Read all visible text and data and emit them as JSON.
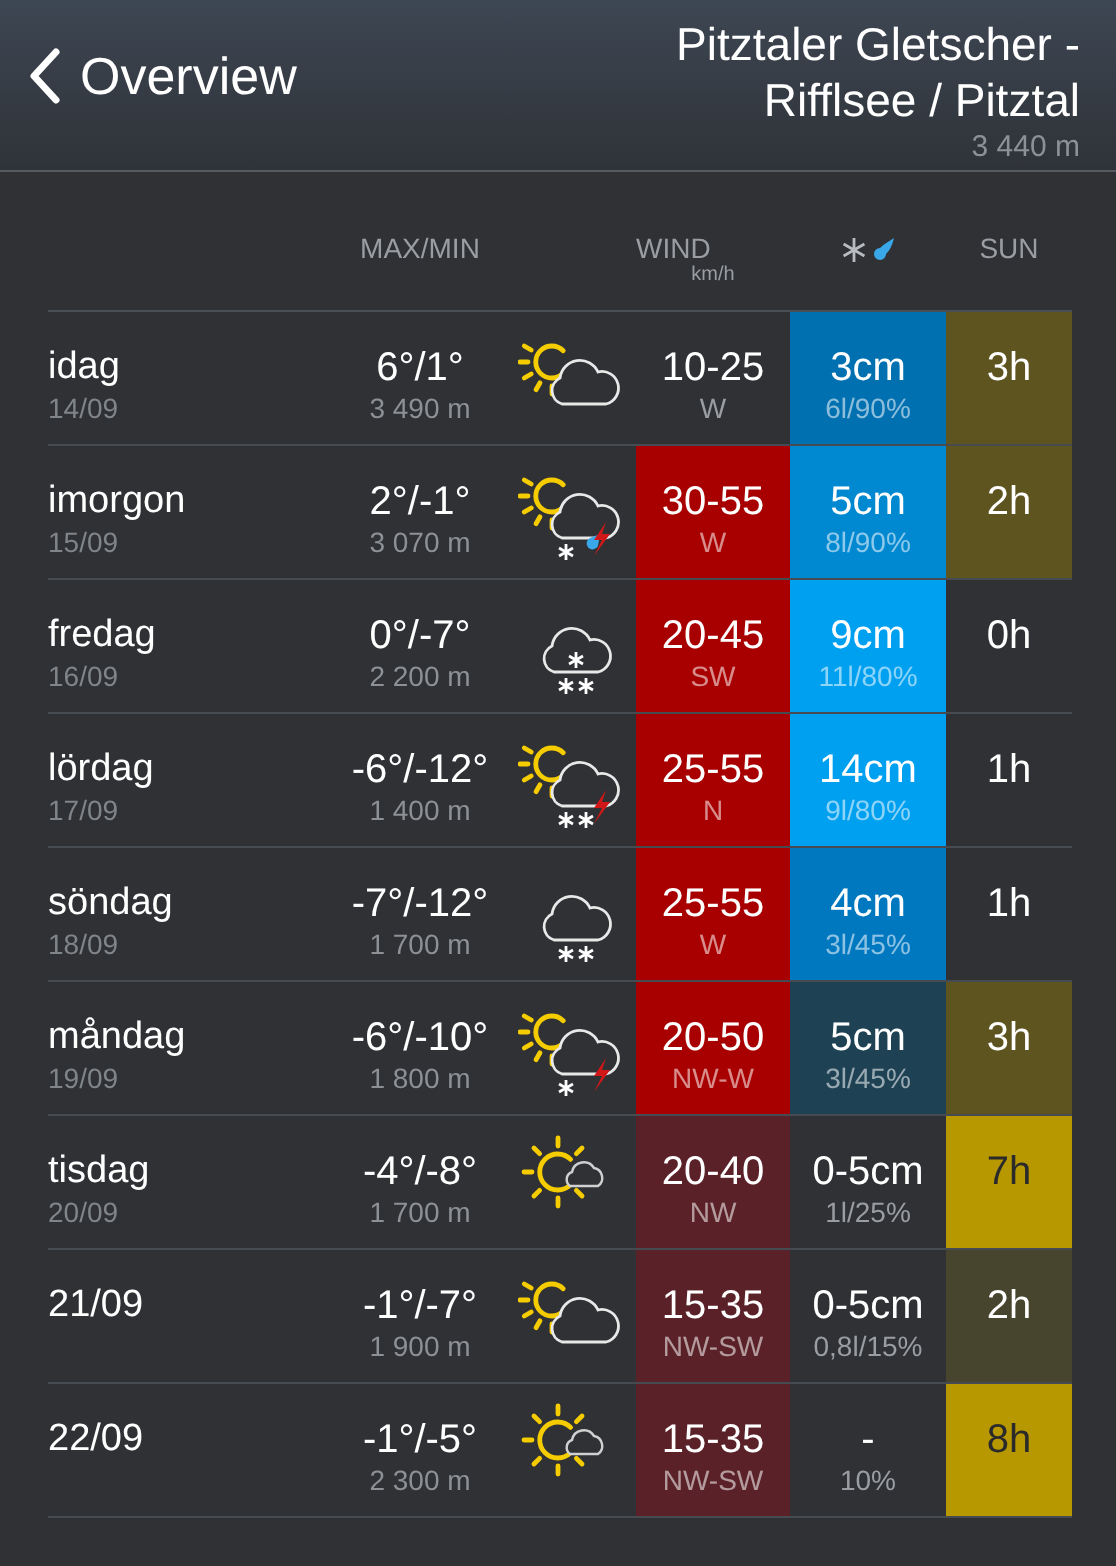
{
  "header": {
    "back_label": "Overview",
    "title": "Pitztaler Gletscher - Rifflsee / Pitztal",
    "altitude": "3 440 m"
  },
  "columns": {
    "temp": "MAX/MIN",
    "wind": "WIND",
    "wind_unit": "km/h",
    "sun": "SUN"
  },
  "rows": [
    {
      "day": "idag",
      "date": "14/09",
      "temp": "6°/1°",
      "altitude": "3 490 m",
      "icon": {
        "kind": "suncloud"
      },
      "wind": {
        "range": "10-25",
        "dir": "W"
      },
      "snow": {
        "amount": "3cm",
        "detail": "6l/90%",
        "color": "#0070b0"
      },
      "sun": {
        "hours": "3h",
        "color": "#5e5420"
      }
    },
    {
      "day": "imorgon",
      "date": "15/09",
      "temp": "2°/-1°",
      "altitude": "3 070 m",
      "icon": {
        "kind": "sunstormsleet"
      },
      "wind": {
        "range": "30-55",
        "dir": "W",
        "color": "#a80000"
      },
      "snow": {
        "amount": "5cm",
        "detail": "8l/90%",
        "color": "#0088d0"
      },
      "sun": {
        "hours": "2h",
        "color": "#5e5420"
      }
    },
    {
      "day": "fredag",
      "date": "16/09",
      "temp": "0°/-7°",
      "altitude": "2 200 m",
      "icon": {
        "kind": "heavysnow"
      },
      "wind": {
        "range": "20-45",
        "dir": "SW",
        "color": "#a80000"
      },
      "snow": {
        "amount": "9cm",
        "detail": "11l/80%",
        "color": "#00a0f0"
      },
      "sun": {
        "hours": "0h"
      }
    },
    {
      "day": "lördag",
      "date": "17/09",
      "temp": "-6°/-12°",
      "altitude": "1 400 m",
      "icon": {
        "kind": "sunstormsnow"
      },
      "wind": {
        "range": "25-55",
        "dir": "N",
        "color": "#a80000"
      },
      "snow": {
        "amount": "14cm",
        "detail": "9l/80%",
        "color": "#00a0f0"
      },
      "sun": {
        "hours": "1h"
      }
    },
    {
      "day": "söndag",
      "date": "18/09",
      "temp": "-7°/-12°",
      "altitude": "1 700 m",
      "icon": {
        "kind": "snow"
      },
      "wind": {
        "range": "25-55",
        "dir": "W",
        "color": "#a80000"
      },
      "snow": {
        "amount": "4cm",
        "detail": "3l/45%",
        "color": "#0078c0"
      },
      "sun": {
        "hours": "1h"
      }
    },
    {
      "day": "måndag",
      "date": "19/09",
      "temp": "-6°/-10°",
      "altitude": "1 800 m",
      "icon": {
        "kind": "sunstormflurry"
      },
      "wind": {
        "range": "20-50",
        "dir": "NW-W",
        "color": "#a80000"
      },
      "snow": {
        "amount": "5cm",
        "detail": "3l/45%",
        "color": "#1e4254"
      },
      "sun": {
        "hours": "3h",
        "color": "#5e5420"
      }
    },
    {
      "day": "tisdag",
      "date": "20/09",
      "temp": "-4°/-8°",
      "altitude": "1 700 m",
      "icon": {
        "kind": "sunny"
      },
      "wind": {
        "range": "20-40",
        "dir": "NW",
        "color": "#5a2228"
      },
      "snow": {
        "amount": "0-5cm",
        "detail": "1l/25%"
      },
      "sun": {
        "hours": "7h",
        "color": "#b89800"
      }
    },
    {
      "day": "21/09",
      "temp": "-1°/-7°",
      "altitude": "1 900 m",
      "icon": {
        "kind": "suncloud"
      },
      "wind": {
        "range": "15-35",
        "dir": "NW-SW",
        "color": "#5a2228"
      },
      "snow": {
        "amount": "0-5cm",
        "detail": "0,8l/15%"
      },
      "sun": {
        "hours": "2h",
        "color": "#48452e"
      }
    },
    {
      "day": "22/09",
      "temp": "-1°/-5°",
      "altitude": "2 300 m",
      "icon": {
        "kind": "sunny"
      },
      "wind": {
        "range": "15-35",
        "dir": "NW-SW",
        "color": "#5a2228"
      },
      "snow": {
        "amount": "-",
        "detail": "10%"
      },
      "sun": {
        "hours": "8h",
        "color": "#b89800"
      }
    }
  ]
}
